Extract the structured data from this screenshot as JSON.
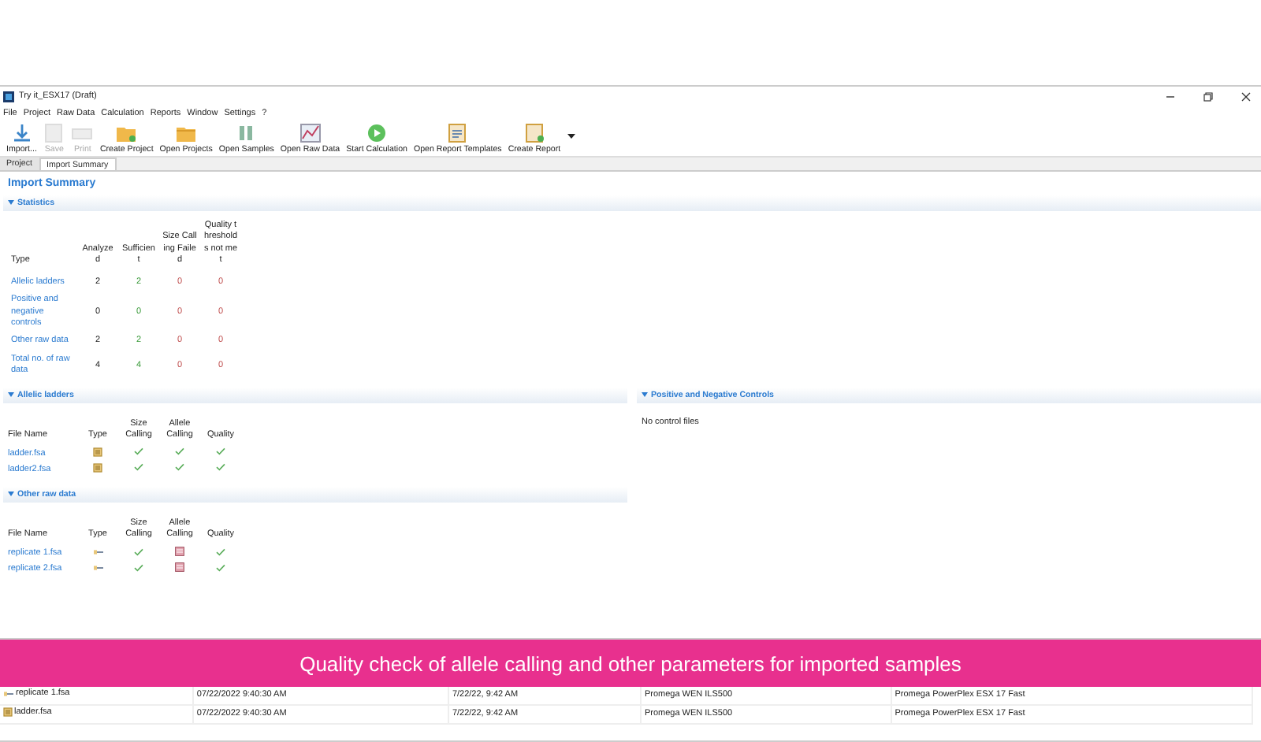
{
  "window": {
    "title": "Try it_ESX17 (Draft)"
  },
  "menu": [
    "File",
    "Project",
    "Raw Data",
    "Calculation",
    "Reports",
    "Window",
    "Settings",
    "?"
  ],
  "toolbar": [
    {
      "label": "Import...",
      "kind": "import",
      "disabled": false
    },
    {
      "label": "Save",
      "kind": "save",
      "disabled": true
    },
    {
      "label": "Print",
      "kind": "print",
      "disabled": true
    },
    {
      "label": "Create Project",
      "kind": "folder-new",
      "disabled": false
    },
    {
      "label": "Open Projects",
      "kind": "folder",
      "disabled": false
    },
    {
      "label": "Open Samples",
      "kind": "samples",
      "disabled": false
    },
    {
      "label": "Open Raw Data",
      "kind": "chart",
      "disabled": false
    },
    {
      "label": "Start Calculation",
      "kind": "play",
      "disabled": false
    },
    {
      "label": "Open Report Templates",
      "kind": "report",
      "disabled": false
    },
    {
      "label": "Create Report",
      "kind": "report-new",
      "disabled": false
    }
  ],
  "tabs": [
    {
      "label": "Project",
      "selected": false
    },
    {
      "label": "Import Summary",
      "selected": true
    }
  ],
  "page_title": "Import Summary",
  "statistics": {
    "title": "Statistics",
    "columns": [
      "Type",
      "Analyzed",
      "Sufficient",
      "Size Calling Failed",
      "Quality thresholds not met"
    ],
    "rows": [
      {
        "type": "Allelic ladders",
        "values": [
          "2",
          "2",
          "0",
          "0"
        ]
      },
      {
        "type": "Positive and negative controls",
        "values": [
          "0",
          "0",
          "0",
          "0"
        ]
      },
      {
        "type": "Other raw data",
        "values": [
          "2",
          "2",
          "0",
          "0"
        ]
      },
      {
        "type": "Total no. of raw data",
        "values": [
          "4",
          "4",
          "0",
          "0"
        ]
      }
    ]
  },
  "allelic_ladders": {
    "title": "Allelic ladders",
    "columns": [
      "File Name",
      "Type",
      "Size Calling",
      "Allele Calling",
      "Quality"
    ],
    "rows": [
      {
        "file": "ladder.fsa",
        "kind": "ladder",
        "size_ok": true,
        "allele_ok": true,
        "quality_ok": true
      },
      {
        "file": "ladder2.fsa",
        "kind": "ladder",
        "size_ok": true,
        "allele_ok": true,
        "quality_ok": true
      }
    ]
  },
  "controls": {
    "title": "Positive and Negative Controls",
    "message": "No control files"
  },
  "other_raw_data": {
    "title": "Other raw data",
    "columns": [
      "File Name",
      "Type",
      "Size Calling",
      "Allele Calling",
      "Quality"
    ],
    "rows": [
      {
        "file": "replicate 1.fsa",
        "kind": "sample",
        "size_ok": true,
        "allele_ok": false,
        "quality_ok": true
      },
      {
        "file": "replicate 2.fsa",
        "kind": "sample",
        "size_ok": true,
        "allele_ok": false,
        "quality_ok": true
      }
    ]
  },
  "raw_data": {
    "rows": [
      {
        "name": "replicate 1.fsa",
        "kind": "sample",
        "imported": "07/22/2022 9:40:30 AM",
        "modified": "7/22/22, 9:42 AM",
        "size_standard": "Promega WEN ILS500",
        "kit": "Promega PowerPlex ESX 17 Fast"
      },
      {
        "name": "ladder.fsa",
        "kind": "ladder",
        "imported": "07/22/2022 9:40:30 AM",
        "modified": "7/22/22, 9:42 AM",
        "size_standard": "Promega WEN ILS500",
        "kit": "Promega PowerPlex ESX 17 Fast"
      }
    ]
  },
  "caption": "Quality check of allele calling and other parameters for imported samples"
}
